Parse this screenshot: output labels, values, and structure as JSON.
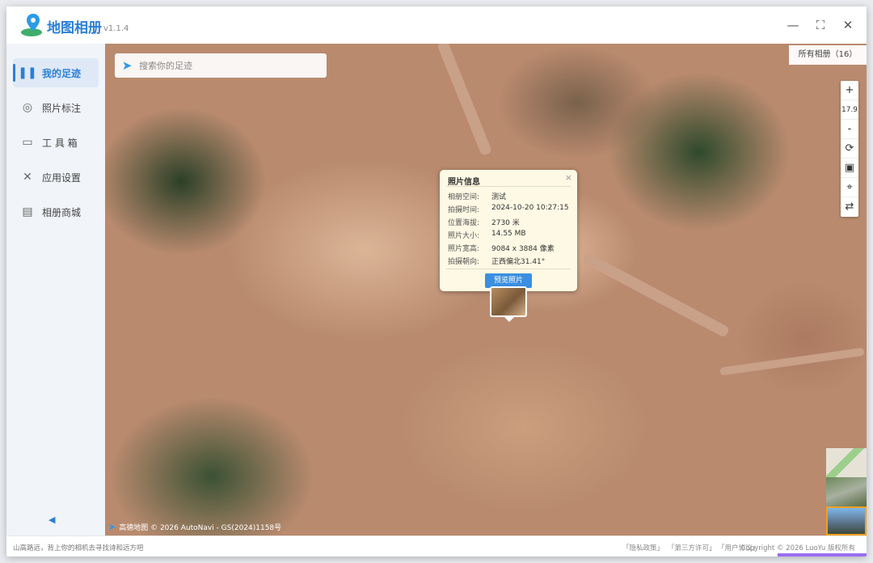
{
  "app": {
    "title": "地图相册",
    "version": "v1.1.4"
  },
  "window_controls": {
    "minimize": "—",
    "maximize": "⛶",
    "close": "✕"
  },
  "sidebar": {
    "items": [
      {
        "label": "我的足迹",
        "icon": "footprint-icon",
        "glyph": "❚❚"
      },
      {
        "label": "照片标注",
        "icon": "target-icon",
        "glyph": "◎"
      },
      {
        "label": "工 具 箱",
        "icon": "toolbox-icon",
        "glyph": "▭"
      },
      {
        "label": "应用设置",
        "icon": "wrench-icon",
        "glyph": "✕"
      },
      {
        "label": "相册商城",
        "icon": "store-icon",
        "glyph": "▤"
      }
    ],
    "collapse_glyph": "◀"
  },
  "search": {
    "placeholder": "搜索你的足迹",
    "icon_glyph": "➤"
  },
  "albums_button": "所有相册（16）",
  "map_tools": {
    "zoom_in": "+",
    "zoom_level": "17.9",
    "zoom_out": "-",
    "rotate": "⟳",
    "image": "▣",
    "locate": "⌖",
    "swap": "⇄"
  },
  "popup": {
    "title": "照片信息",
    "close": "×",
    "rows": [
      {
        "key": "相册空间:",
        "value": "测试"
      },
      {
        "key": "拍摄时间:",
        "value": "2024-10-20 10:27:15"
      },
      {
        "key": "位置海拔:",
        "value": "2730 米"
      },
      {
        "key": "照片大小:",
        "value": "14.55 MB"
      },
      {
        "key": "照片宽高:",
        "value": "9084 x 3884 像素"
      },
      {
        "key": "拍摄朝向:",
        "value": "正西偏北31.41°"
      }
    ],
    "preview_button": "预览照片"
  },
  "attribution": "高德地图 © 2026 AutoNavi - GS(2024)1158号",
  "statusbar": {
    "slogan": "山高路远，背上你的相机去寻找诗和远方吧",
    "links": [
      "「隐私政策」",
      "「第三方许可」",
      "「用户协议」"
    ],
    "copyright": "Copyright © 2026 LuoYu 版权所有"
  },
  "colors": {
    "accent": "#2b7fd6",
    "preview_button": "#3b8fe0"
  }
}
